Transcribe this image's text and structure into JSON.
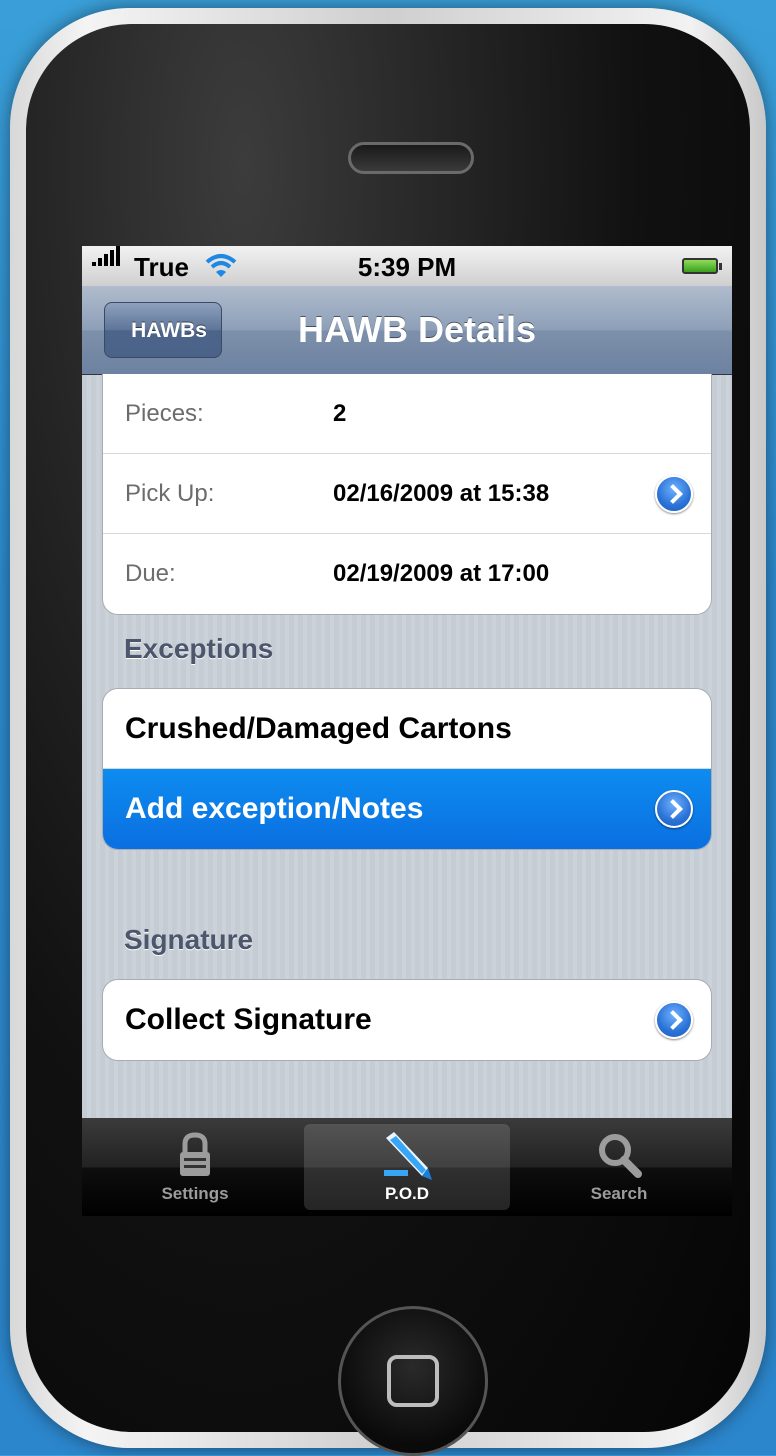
{
  "status_bar": {
    "carrier": "True",
    "time": "5:39 PM"
  },
  "nav": {
    "back_label": "HAWBs",
    "title": "HAWB Details"
  },
  "details": [
    {
      "label": "Pieces:",
      "value": "2",
      "has_disclosure": false
    },
    {
      "label": "Pick Up:",
      "value": "02/16/2009 at 15:38",
      "has_disclosure": true
    },
    {
      "label": "Due:",
      "value": "02/19/2009 at 17:00",
      "has_disclosure": false
    }
  ],
  "exceptions": {
    "header": "Exceptions",
    "items": [
      {
        "title": "Crushed/Damaged Cartons",
        "selected": false
      },
      {
        "title": "Add exception/Notes",
        "selected": true
      }
    ]
  },
  "signature": {
    "header": "Signature",
    "items": [
      {
        "title": "Collect Signature"
      }
    ]
  },
  "tabs": [
    {
      "label": "Settings",
      "icon": "lock-icon",
      "active": false
    },
    {
      "label": "P.O.D",
      "icon": "pen-icon",
      "active": true
    },
    {
      "label": "Search",
      "icon": "magnifier-icon",
      "active": false
    }
  ],
  "colors": {
    "selection_blue": "#0b6fe0",
    "nav_blue": "#6d82a1",
    "section_header": "#4c566c"
  }
}
